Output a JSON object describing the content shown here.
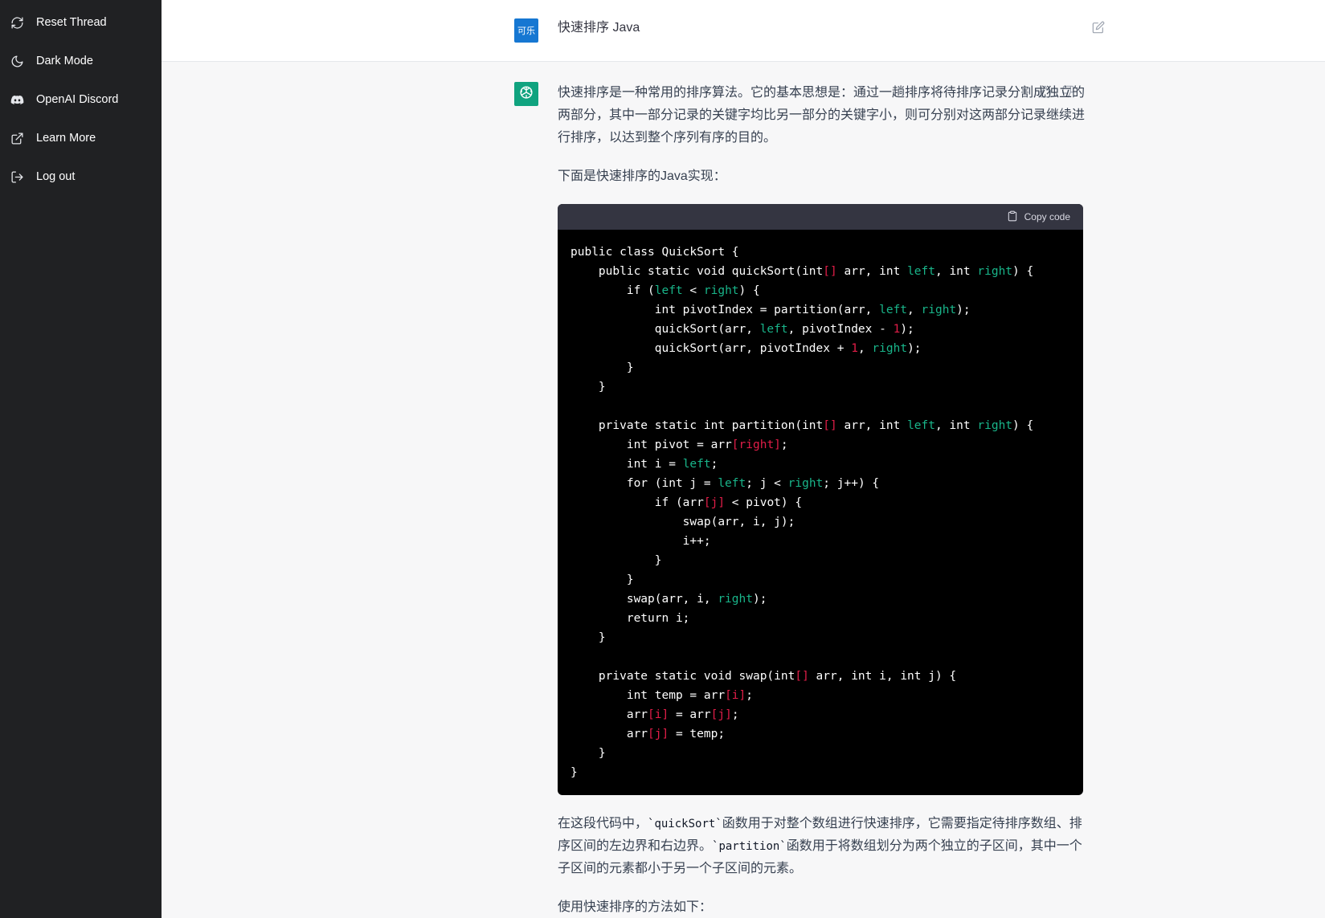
{
  "sidebar": {
    "items": [
      {
        "label": "Reset Thread",
        "icon": "refresh-icon"
      },
      {
        "label": "Dark Mode",
        "icon": "moon-icon"
      },
      {
        "label": "OpenAI Discord",
        "icon": "discord-icon"
      },
      {
        "label": "Learn More",
        "icon": "external-link-icon"
      },
      {
        "label": "Log out",
        "icon": "logout-icon"
      }
    ]
  },
  "user": {
    "avatar_text": "可乐",
    "message": "快速排序 Java"
  },
  "assistant": {
    "intro": "快速排序是一种常用的排序算法。它的基本思想是：通过一趟排序将待排序记录分割成独立的两部分，其中一部分记录的关键字均比另一部分的关键字小，则可分别对这两部分记录继续进行排序，以达到整个序列有序的目的。",
    "lead": "下面是快速排序的Java实现：",
    "copy_label": "Copy code",
    "explain_parts": [
      "在这段代码中，",
      "`quickSort`",
      "函数用于对整个数组进行快速排序，它需要指定待排序数组、排序区间的左边界和右边界。",
      "`partition`",
      "函数用于将数组划分为两个独立的子区间，其中一个子区间的元素都小于另一个子区间的元素。"
    ],
    "usage": "使用快速排序的方法如下："
  },
  "code_lines": [
    [
      [
        "public class QuickSort {",
        ""
      ]
    ],
    [
      [
        "    public static void quickSort(int",
        ""
      ],
      [
        "[]",
        "r"
      ],
      [
        " arr, int ",
        ""
      ],
      [
        "left",
        "g"
      ],
      [
        ", int ",
        ""
      ],
      [
        "right",
        "g"
      ],
      [
        ") {",
        ""
      ]
    ],
    [
      [
        "        if (",
        ""
      ],
      [
        "left",
        "g"
      ],
      [
        " < ",
        ""
      ],
      [
        "right",
        "g"
      ],
      [
        ") {",
        ""
      ]
    ],
    [
      [
        "            int pivotIndex = partition(arr, ",
        ""
      ],
      [
        "left",
        "g"
      ],
      [
        ", ",
        ""
      ],
      [
        "right",
        "g"
      ],
      [
        ");",
        ""
      ]
    ],
    [
      [
        "            quickSort(arr, ",
        ""
      ],
      [
        "left",
        "g"
      ],
      [
        ", pivotIndex - ",
        ""
      ],
      [
        "1",
        "r"
      ],
      [
        ");",
        ""
      ]
    ],
    [
      [
        "            quickSort(arr, pivotIndex + ",
        ""
      ],
      [
        "1",
        "r"
      ],
      [
        ", ",
        ""
      ],
      [
        "right",
        "g"
      ],
      [
        ");",
        ""
      ]
    ],
    [
      [
        "        }",
        ""
      ]
    ],
    [
      [
        "    }",
        ""
      ]
    ],
    [
      [
        "",
        ""
      ]
    ],
    [
      [
        "    private static int partition(int",
        ""
      ],
      [
        "[]",
        "r"
      ],
      [
        " arr, int ",
        ""
      ],
      [
        "left",
        "g"
      ],
      [
        ", int ",
        ""
      ],
      [
        "right",
        "g"
      ],
      [
        ") {",
        ""
      ]
    ],
    [
      [
        "        int pivot = arr",
        ""
      ],
      [
        "[right]",
        "r"
      ],
      [
        ";",
        ""
      ]
    ],
    [
      [
        "        int i = ",
        ""
      ],
      [
        "left",
        "g"
      ],
      [
        ";",
        ""
      ]
    ],
    [
      [
        "        for (int j = ",
        ""
      ],
      [
        "left",
        "g"
      ],
      [
        "; j < ",
        ""
      ],
      [
        "right",
        "g"
      ],
      [
        "; j++) {",
        ""
      ]
    ],
    [
      [
        "            if (arr",
        ""
      ],
      [
        "[j]",
        "r"
      ],
      [
        " < pivot) {",
        ""
      ]
    ],
    [
      [
        "                swap(arr, i, j);",
        ""
      ]
    ],
    [
      [
        "                i++;",
        ""
      ]
    ],
    [
      [
        "            }",
        ""
      ]
    ],
    [
      [
        "        }",
        ""
      ]
    ],
    [
      [
        "        swap(arr, i, ",
        ""
      ],
      [
        "right",
        "g"
      ],
      [
        ");",
        ""
      ]
    ],
    [
      [
        "        return i;",
        ""
      ]
    ],
    [
      [
        "    }",
        ""
      ]
    ],
    [
      [
        "",
        ""
      ]
    ],
    [
      [
        "    private static void swap(int",
        ""
      ],
      [
        "[]",
        "r"
      ],
      [
        " arr, int i, int j) {",
        ""
      ]
    ],
    [
      [
        "        int temp = arr",
        ""
      ],
      [
        "[i]",
        "r"
      ],
      [
        ";",
        ""
      ]
    ],
    [
      [
        "        arr",
        ""
      ],
      [
        "[i]",
        "r"
      ],
      [
        " = arr",
        ""
      ],
      [
        "[j]",
        "r"
      ],
      [
        ";",
        ""
      ]
    ],
    [
      [
        "        arr",
        ""
      ],
      [
        "[j]",
        "r"
      ],
      [
        " = temp;",
        ""
      ]
    ],
    [
      [
        "    }",
        ""
      ]
    ],
    [
      [
        "}",
        ""
      ]
    ]
  ],
  "colors": {
    "sidebar_bg": "#202123",
    "accent_green": "#10a37f",
    "code_bg": "#000000",
    "code_keyword_green": "#19b58a",
    "code_literal_red": "#e11d48",
    "user_avatar_bg": "#1677d2"
  }
}
